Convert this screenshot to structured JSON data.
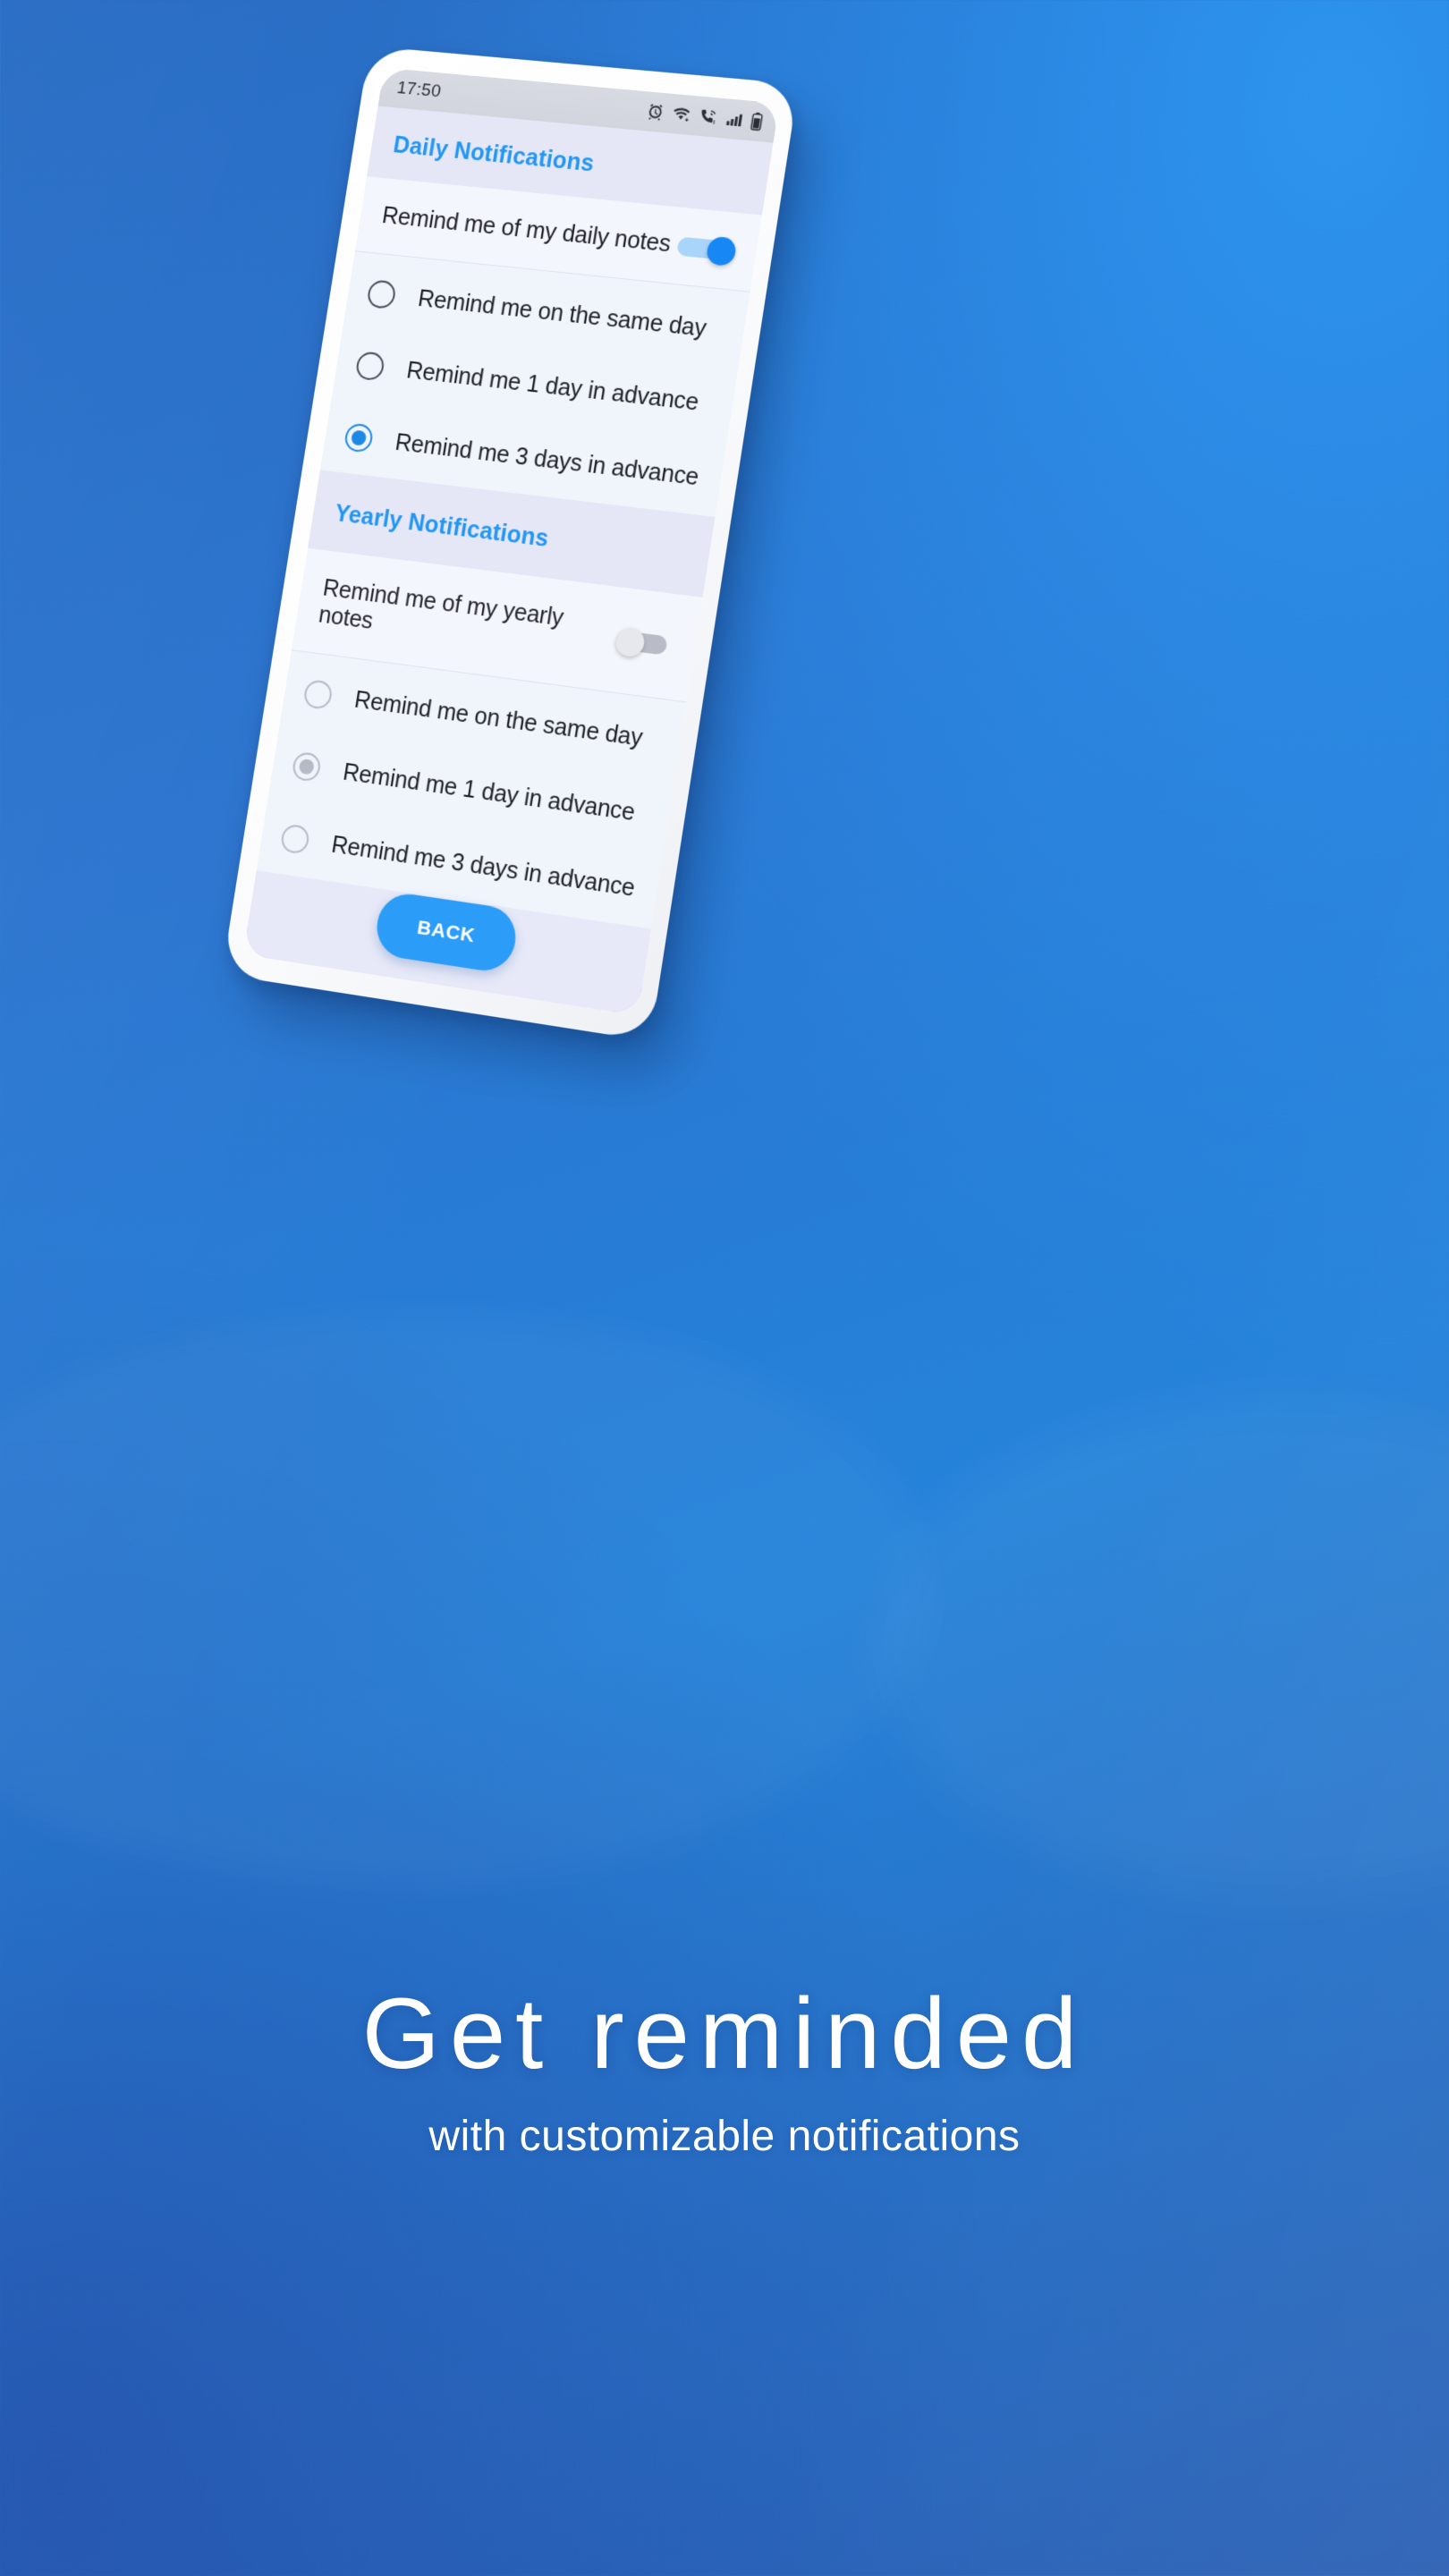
{
  "background": {
    "gradient_from": "#2369c3",
    "gradient_mid": "#2583da",
    "gradient_to": "#2b5fb3"
  },
  "phone": {
    "statusbar": {
      "time": "17:50",
      "icons": [
        "alarm-clock-icon",
        "wifi-icon",
        "wifi-calling-icon",
        "cellular-signal-icon",
        "battery-icon"
      ]
    },
    "screen": {
      "accent_color": "#2196f3",
      "sections": [
        {
          "id": "daily",
          "header": "Daily Notifications",
          "switch": {
            "label": "Remind me of my daily notes",
            "state": "on"
          },
          "options": [
            {
              "label": "Remind me on the same day",
              "selected": false
            },
            {
              "label": "Remind me 1 day in advance",
              "selected": false
            },
            {
              "label": "Remind me 3 days in advance",
              "selected": true
            }
          ]
        },
        {
          "id": "yearly",
          "header": "Yearly Notifications",
          "switch": {
            "label": "Remind me of my yearly notes",
            "state": "off"
          },
          "options": [
            {
              "label": "Remind me on the same day",
              "selected": false
            },
            {
              "label": "Remind me 1 day in advance",
              "selected": true
            },
            {
              "label": "Remind me 3 days in advance",
              "selected": false
            }
          ]
        }
      ],
      "back_button": {
        "label": "BACK",
        "color": "#2b9cf7"
      }
    }
  },
  "caption": {
    "title": "Get reminded",
    "subtitle": "with customizable notifications"
  }
}
